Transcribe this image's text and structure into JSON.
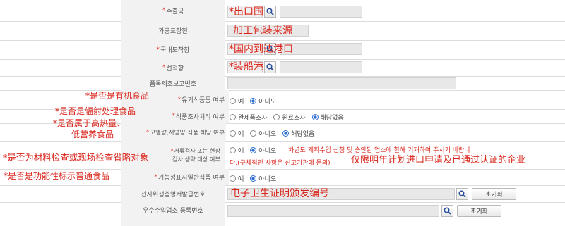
{
  "rows": [
    {
      "label": "수출국",
      "required": true
    },
    {
      "label": "가공포장현",
      "required": false
    },
    {
      "label": "국내도착항",
      "required": true
    },
    {
      "label": "선적항",
      "required": true
    },
    {
      "label": "품목제조보고번호",
      "required": false
    },
    {
      "label": "유기식품등 여부",
      "required": true
    },
    {
      "label": "식품조사처리 여부",
      "required": true
    },
    {
      "label": "고열량,저영양 식품 해당 여부",
      "required": true
    },
    {
      "label": "서류검사 또는 현장검사 생략 대상 여부",
      "required": true
    },
    {
      "label": "기능성표시일반식품 여부",
      "required": true
    },
    {
      "label": "전자위생증명서발급번호",
      "required": false
    },
    {
      "label": "우수수입업소 등록번호",
      "required": false
    }
  ],
  "star": "*",
  "annotations": {
    "export_country": "*出口国",
    "processing": "加工包装来源",
    "arrival_port": "*国内到达港口",
    "loading_port": "*装船港",
    "organic": "*是否是有机食品",
    "irradiation": "*是否是辐射处理食品",
    "high_calorie_1": "*是否属于高热量、",
    "high_calorie_2": "低营养食品",
    "inspection_skip": "*是否为材料检查或现场检查省略对象",
    "functional": "*是否是功能性标示普通食品",
    "inspection_note": "仅限明年计划进口申请及已通过认证的企业",
    "ecert": "电子卫生证明颁发编号"
  },
  "options": {
    "yes": "예",
    "no": "아니오",
    "full_inspection": "완제품조사",
    "raw_inspection": "원료조사",
    "not_applicable": "해당없음"
  },
  "selected": {
    "organic": "no",
    "irradiation": "not_applicable",
    "high_calorie": "not_applicable",
    "inspection_skip": "no",
    "functional": "no"
  },
  "inspection_notice_1": "차년도 계획수입 신청 및 승안된 업소에 한해 기재하여 주시기 바랍니",
  "inspection_notice_2": "다.(구체적인 사항은 신고기관에 문의)",
  "reset_label": "초기화",
  "colors": {
    "annotation": "#d9261c",
    "label_bg": "#f2f2f2",
    "radio_selected": "#2d6fd1"
  }
}
